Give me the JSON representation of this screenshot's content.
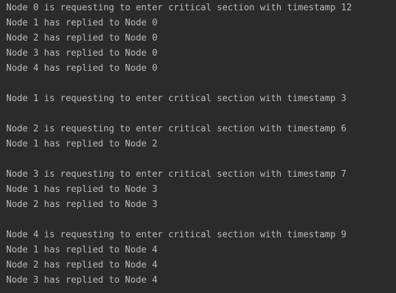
{
  "console": {
    "lines": [
      "Node 0 is requesting to enter critical section with timestamp 12",
      "Node 1 has replied to Node 0",
      "Node 2 has replied to Node 0",
      "Node 3 has replied to Node 0",
      "Node 4 has replied to Node 0",
      "",
      "Node 1 is requesting to enter critical section with timestamp 3",
      "",
      "Node 2 is requesting to enter critical section with timestamp 6",
      "Node 1 has replied to Node 2",
      "",
      "Node 3 is requesting to enter critical section with timestamp 7",
      "Node 1 has replied to Node 3",
      "Node 2 has replied to Node 3",
      "",
      "Node 4 is requesting to enter critical section with timestamp 9",
      "Node 1 has replied to Node 4",
      "Node 2 has replied to Node 4",
      "Node 3 has replied to Node 4"
    ]
  },
  "colors": {
    "background": "#2b2b2b",
    "text": "#bbbbbb"
  }
}
